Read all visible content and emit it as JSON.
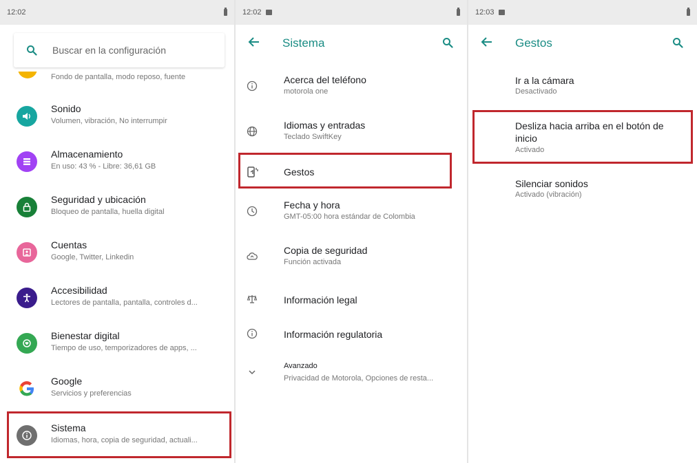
{
  "panel1": {
    "status_time": "12:02",
    "search_placeholder": "Buscar en la configuración",
    "clipped_subtitle": "Fondo de pantalla, modo reposo, fuente",
    "items": [
      {
        "title": "Sonido",
        "subtitle": "Volumen, vibración, No interrumpir",
        "icon": "volume-icon",
        "color": "#17a6a0"
      },
      {
        "title": "Almacenamiento",
        "subtitle": "En uso: 43 % - Libre: 36,61 GB",
        "icon": "storage-icon",
        "color": "#a142f4"
      },
      {
        "title": "Seguridad y ubicación",
        "subtitle": "Bloqueo de pantalla, huella digital",
        "icon": "lock-icon",
        "color": "#188038"
      },
      {
        "title": "Cuentas",
        "subtitle": "Google, Twitter, Linkedin",
        "icon": "account-icon",
        "color": "#e8669a"
      },
      {
        "title": "Accesibilidad",
        "subtitle": "Lectores de pantalla, pantalla, controles d...",
        "icon": "accessibility-icon",
        "color": "#3a1c8c"
      },
      {
        "title": "Bienestar digital",
        "subtitle": "Tiempo de uso, temporizadores de apps, ...",
        "icon": "wellbeing-icon",
        "color": "#34a853"
      },
      {
        "title": "Google",
        "subtitle": "Servicios y preferencias",
        "icon": "google-icon",
        "color": "#ffffff"
      },
      {
        "title": "Sistema",
        "subtitle": "Idiomas, hora, copia de seguridad, actuali...",
        "icon": "system-info-icon",
        "color": "#6f6f6f"
      }
    ]
  },
  "panel2": {
    "status_time": "12:02",
    "title": "Sistema",
    "items": [
      {
        "title": "Acerca del teléfono",
        "subtitle": "motorola one",
        "icon": "info-icon"
      },
      {
        "title": "Idiomas y entradas",
        "subtitle": "Teclado SwiftKey",
        "icon": "globe-icon"
      },
      {
        "title": "Gestos",
        "subtitle": "",
        "icon": "gestures-icon"
      },
      {
        "title": "Fecha y hora",
        "subtitle": "GMT-05:00 hora estándar de Colombia",
        "icon": "clock-icon"
      },
      {
        "title": "Copia de seguridad",
        "subtitle": "Función activada",
        "icon": "backup-icon"
      },
      {
        "title": "Información legal",
        "subtitle": "",
        "icon": "legal-icon"
      },
      {
        "title": "Información regulatoria",
        "subtitle": "",
        "icon": "info-icon"
      },
      {
        "title": "Avanzado",
        "subtitle": "Privacidad de Motorola, Opciones de resta...",
        "icon": "chevron-down-icon"
      }
    ]
  },
  "panel3": {
    "status_time": "12:03",
    "title": "Gestos",
    "items": [
      {
        "title": "Ir a la cámara",
        "subtitle": "Desactivado"
      },
      {
        "title": "Desliza hacia arriba en el botón de inicio",
        "subtitle": "Activado"
      },
      {
        "title": "Silenciar sonidos",
        "subtitle": "Activado (vibración)"
      }
    ]
  },
  "colors": {
    "accent": "#1a8c84",
    "highlight": "#c0272d"
  }
}
